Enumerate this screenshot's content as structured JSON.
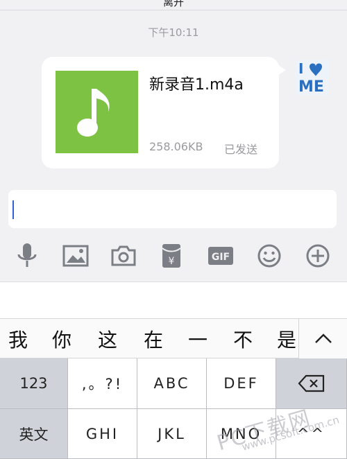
{
  "header": {
    "title": "离开"
  },
  "chat": {
    "timestamp": "下午10:11",
    "message": {
      "file_name": "新录音1.m4a",
      "file_size": "258.06KB",
      "status": "已发送",
      "thumb_color": "#7dc242",
      "thumb_icon": "music-note-icon"
    },
    "avatar_text": "I ♥ ME"
  },
  "input": {
    "value": ""
  },
  "toolbar": {
    "items": [
      {
        "name": "voice",
        "icon": "microphone-icon"
      },
      {
        "name": "image",
        "icon": "image-icon"
      },
      {
        "name": "camera",
        "icon": "camera-icon"
      },
      {
        "name": "red-packet",
        "icon": "red-packet-icon",
        "label": "¥"
      },
      {
        "name": "gif",
        "icon": "gif-icon",
        "label": "GIF"
      },
      {
        "name": "emoji",
        "icon": "emoji-icon"
      },
      {
        "name": "more",
        "icon": "plus-icon"
      }
    ]
  },
  "candidates": [
    "我",
    "你",
    "这",
    "在",
    "一",
    "不",
    "是"
  ],
  "keyboard": {
    "row1": [
      "123",
      ",。?!",
      "ABC",
      "DEF"
    ],
    "row2": [
      "英文",
      "GHI",
      "JKL",
      "MNO",
      "^^"
    ]
  },
  "watermark": {
    "text": "PC下载网",
    "url": "www.pcsoft.com.cn"
  }
}
